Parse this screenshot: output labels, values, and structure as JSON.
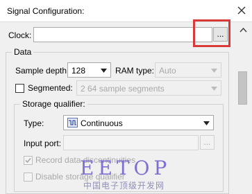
{
  "window": {
    "title": "Signal Configuration:"
  },
  "clock": {
    "label": "Clock:",
    "value": "",
    "browse_label": "..."
  },
  "data_group": {
    "legend": "Data",
    "sample_depth": {
      "label": "Sample depth:",
      "value": "128"
    },
    "ram_type": {
      "label": "RAM type:",
      "value": "Auto"
    },
    "segmented": {
      "label": "Segmented:",
      "checked": false,
      "value": "2  64 sample segments"
    }
  },
  "storage_qualifier": {
    "legend": "Storage qualifier:",
    "type": {
      "label": "Type:",
      "value": "Continuous",
      "icon": "continuous-waveform-icon"
    },
    "input_port": {
      "label": "Input port:",
      "value": "",
      "browse_label": "..."
    },
    "record_discontinuities": {
      "label": "Record data discontinuities",
      "checked": true
    },
    "disable_qualifier": {
      "label": "Disable storage qualifier",
      "checked": false
    }
  },
  "watermark": {
    "text": "EETOP",
    "subtext": "中国电子顶级开发网"
  },
  "colors": {
    "highlight": "#d83a3a",
    "watermark": "#6a5acd"
  }
}
